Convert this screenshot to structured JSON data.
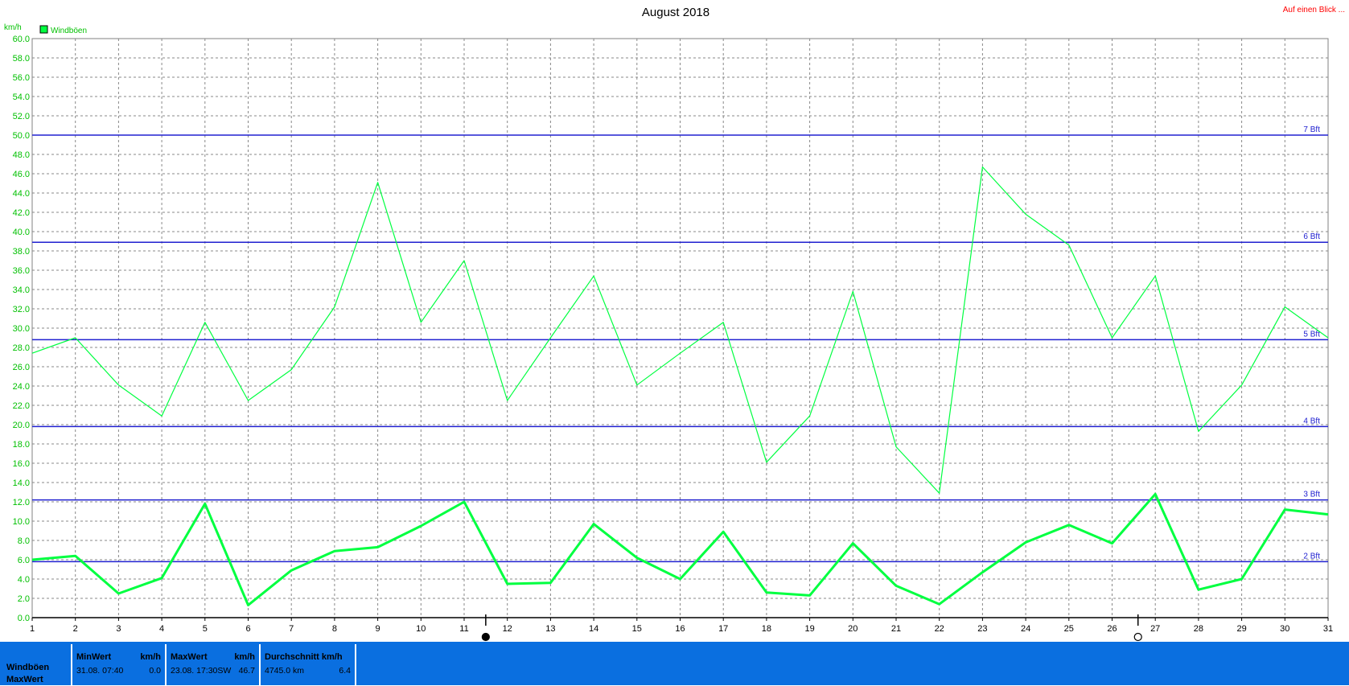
{
  "title": "August 2018",
  "link_text": "Auf einen Blick ...",
  "y_unit_label": "km/h",
  "legend": {
    "label": "Windböen"
  },
  "colors": {
    "series": "#00ff40",
    "beaufort_line": "#2020d0",
    "axis_text": "#00c000",
    "link": "#ff0000",
    "panel": "#0a6fe0"
  },
  "beaufort_lines": [
    {
      "label": "2 Bft",
      "value": 5.8
    },
    {
      "label": "3 Bft",
      "value": 12.2
    },
    {
      "label": "4 Bft",
      "value": 19.8
    },
    {
      "label": "5 Bft",
      "value": 28.8
    },
    {
      "label": "6 Bft",
      "value": 38.9
    },
    {
      "label": "7 Bft",
      "value": 50.0
    }
  ],
  "moon_markers": [
    {
      "day": 11.5,
      "icon": "new-moon-icon"
    },
    {
      "day": 26.6,
      "icon": "full-moon-icon"
    }
  ],
  "chart_data": {
    "type": "line",
    "title": "August 2018",
    "ylabel": "km/h",
    "x": [
      1,
      2,
      3,
      4,
      5,
      6,
      7,
      8,
      9,
      10,
      11,
      12,
      13,
      14,
      15,
      16,
      17,
      18,
      19,
      20,
      21,
      22,
      23,
      24,
      25,
      26,
      27,
      28,
      29,
      30,
      31
    ],
    "xlim": [
      1,
      31
    ],
    "ylim": [
      0,
      60
    ],
    "yticks": [
      0,
      2,
      4,
      6,
      8,
      10,
      12,
      14,
      16,
      18,
      20,
      22,
      24,
      26,
      28,
      30,
      32,
      34,
      36,
      38,
      40,
      42,
      44,
      46,
      48,
      50,
      52,
      54,
      56,
      58,
      60
    ],
    "grid": true,
    "legend_position": "top-left",
    "series": [
      {
        "name": "Windböen",
        "style": "max",
        "values": [
          27.4,
          29.0,
          24.1,
          20.9,
          30.6,
          22.5,
          25.7,
          32.2,
          45.1,
          30.6,
          37.0,
          22.5,
          29.0,
          35.4,
          24.1,
          27.4,
          30.6,
          16.1,
          20.9,
          33.8,
          17.7,
          12.9,
          46.7,
          41.8,
          38.6,
          29.0,
          35.4,
          19.3,
          24.1,
          32.2,
          29.0
        ]
      },
      {
        "name": "",
        "style": "average",
        "values": [
          6.0,
          6.4,
          2.5,
          4.1,
          11.8,
          1.3,
          4.9,
          6.9,
          7.3,
          9.5,
          12.0,
          3.5,
          3.6,
          9.7,
          6.2,
          4.0,
          8.9,
          2.6,
          2.3,
          7.7,
          3.3,
          1.4,
          4.7,
          7.8,
          9.6,
          7.7,
          12.8,
          2.9,
          4.0,
          11.2,
          10.7
        ]
      }
    ]
  },
  "stats": {
    "row_labels": [
      "Windböen",
      "MaxWert"
    ],
    "min": {
      "header": "MinWert",
      "unit": "km/h",
      "when": "31.08.  07:40",
      "value": "0.0"
    },
    "max": {
      "header": "MaxWert",
      "unit": "km/h",
      "when": "23.08.  17:30SW",
      "value": "46.7"
    },
    "avg": {
      "header": "Durchschnitt km/h",
      "distance": "4745.0 km",
      "value": "6.4"
    }
  }
}
